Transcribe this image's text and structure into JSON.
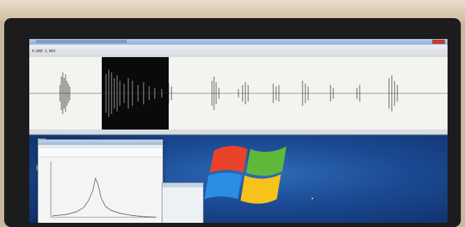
{
  "scene": "monitor-photo",
  "waveform_app": {
    "readout": "0,000  2,963"
  },
  "colors": {
    "desktop": "#1b4a93",
    "waveform_bg": "#f3f3f0",
    "selection": "#0a0a0a",
    "wave": "#111111"
  },
  "icons": [
    "windows-logo",
    "desktop-icon"
  ]
}
